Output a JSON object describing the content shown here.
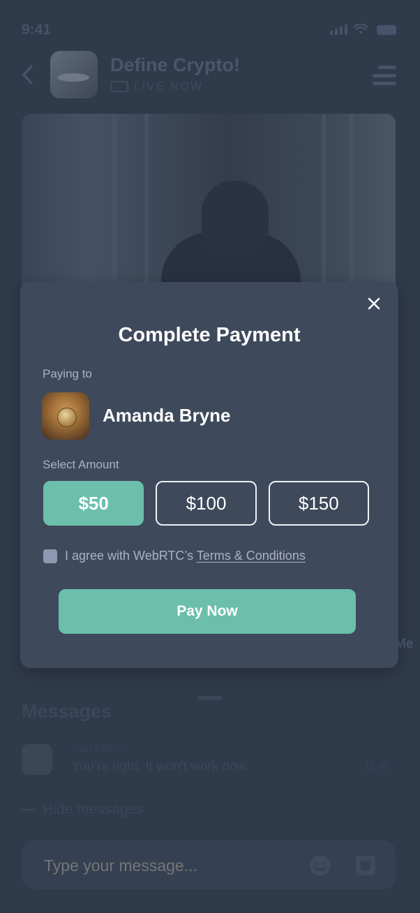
{
  "status_bar": {
    "time": "9:41"
  },
  "header": {
    "title": "Define Crypto!",
    "live_label": "LIVE NOW"
  },
  "background": {
    "me_label": "Me",
    "messages_title": "Messages",
    "message": {
      "name": "Tom Climn",
      "text": "You're right. It won't work now.",
      "time": "12:45"
    },
    "hide_messages": "Hide messages",
    "composer_placeholder": "Type your message..."
  },
  "payment": {
    "title": "Complete Payment",
    "paying_to_label": "Paying to",
    "recipient_name": "Amanda Bryne",
    "select_amount_label": "Select Amount",
    "amounts": [
      "$50",
      "$100",
      "$150"
    ],
    "selected_amount": "$50",
    "terms_prefix": "I agree with WebRTC’s ",
    "terms_link": "Terms & Conditions",
    "terms_checked": false,
    "pay_button": "Pay Now"
  },
  "colors": {
    "accent": "#6bbfab",
    "modal_bg": "#3e495b",
    "screen_bg": "#2f3a4b",
    "muted_text": "#a9b3c4"
  },
  "icons": [
    "back-icon",
    "menu-icon",
    "video-camera-icon",
    "close-icon",
    "emoji-icon",
    "image-icon",
    "signal-icon",
    "wifi-icon",
    "battery-icon"
  ]
}
